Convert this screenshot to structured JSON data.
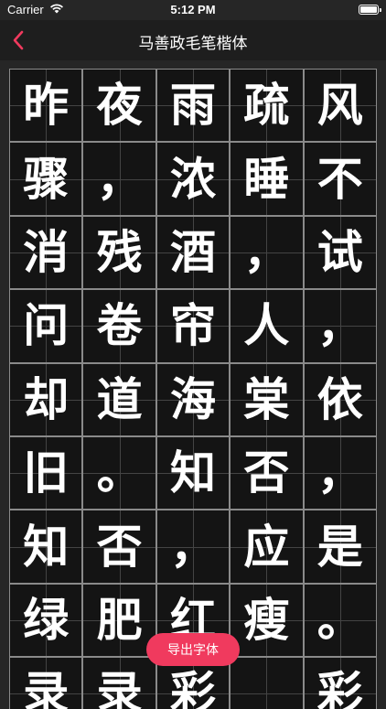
{
  "status_bar": {
    "carrier": "Carrier",
    "time": "5:12 PM",
    "battery_level": 1.0
  },
  "nav": {
    "title": "马善政毛笔楷体",
    "back_icon": "chevron-left-icon",
    "accent_color": "#f03a5e"
  },
  "grid": {
    "columns": 5,
    "characters": [
      "昨",
      "夜",
      "雨",
      "疏",
      "风",
      "骤",
      "，",
      "浓",
      "睡",
      "不",
      "消",
      "残",
      "酒",
      "，",
      "试",
      "问",
      "卷",
      "帘",
      "人",
      "，",
      "却",
      "道",
      "海",
      "棠",
      "依",
      "旧",
      "。",
      "知",
      "否",
      "，",
      "知",
      "否",
      "，",
      "应",
      "是",
      "绿",
      "肥",
      "红",
      "瘦",
      "。",
      "录",
      "录",
      "彩",
      "",
      "彩"
    ]
  },
  "export_button": {
    "label": "导出字体",
    "color": "#f03a5e"
  }
}
